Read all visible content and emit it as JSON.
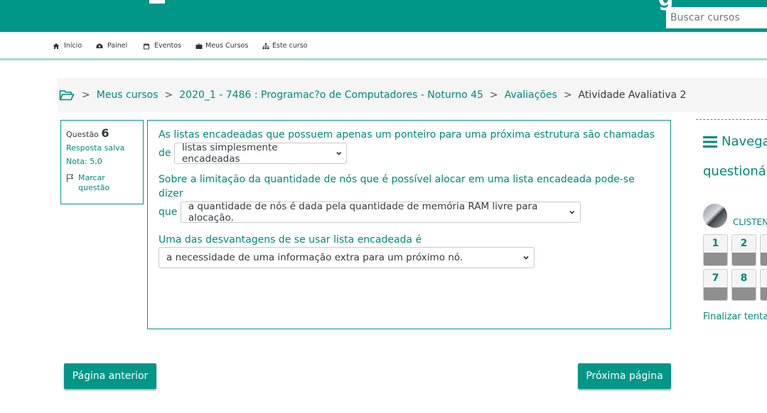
{
  "header": {
    "search_placeholder": "Buscar cursos",
    "brand_partial": "g"
  },
  "nav": {
    "items": [
      {
        "label": "Início",
        "icon": "home-icon"
      },
      {
        "label": "Painel",
        "icon": "dashboard-icon"
      },
      {
        "label": "Eventos",
        "icon": "calendar-icon"
      },
      {
        "label": "Meus Cursos",
        "icon": "briefcase-icon"
      },
      {
        "label": "Este curso",
        "icon": "sitemap-icon"
      }
    ]
  },
  "breadcrumb": {
    "items": [
      "Meus cursos",
      "2020_1 - 7486 : Programac?o de Computadores - Noturno 45",
      "Avaliações"
    ],
    "current": "Atividade Avaliativa 2",
    "separator": ">"
  },
  "question_info": {
    "label": "Questão",
    "number": "6",
    "state": "Resposta salva",
    "grade": "Nota: 5,0",
    "flag_label_1": "Marcar",
    "flag_label_2": "questão"
  },
  "question": {
    "q1_text_a": "As listas encadeadas que possuem apenas um ponteiro para uma próxima estrutura são chamadas",
    "q1_text_b": "de",
    "q1_selected": "listas simplesmente encadeadas",
    "q2_text_a": "Sobre a limitação da quantidade de nós que é possível alocar em uma lista encadeada pode-se dizer",
    "q2_text_b": "que",
    "q2_selected": "a quantidade de nós é dada pela quantidade de memória RAM livre para alocação.",
    "q3_text": "Uma das desvantagens de se usar lista encadeada é",
    "q3_selected": "a necessidade de uma informação extra para um próximo nó."
  },
  "buttons": {
    "prev": "Página anterior",
    "next": "Próxima página"
  },
  "sidebar": {
    "title_1": "Navega",
    "title_2": "questionár",
    "user_name": "CLISTEN",
    "question_numbers": [
      "1",
      "2",
      "",
      "7",
      "8",
      ""
    ],
    "finish": "Finalizar tenta"
  },
  "colors": {
    "primary": "#009688",
    "link": "#00897b",
    "border_light": "#a8d8cf"
  }
}
